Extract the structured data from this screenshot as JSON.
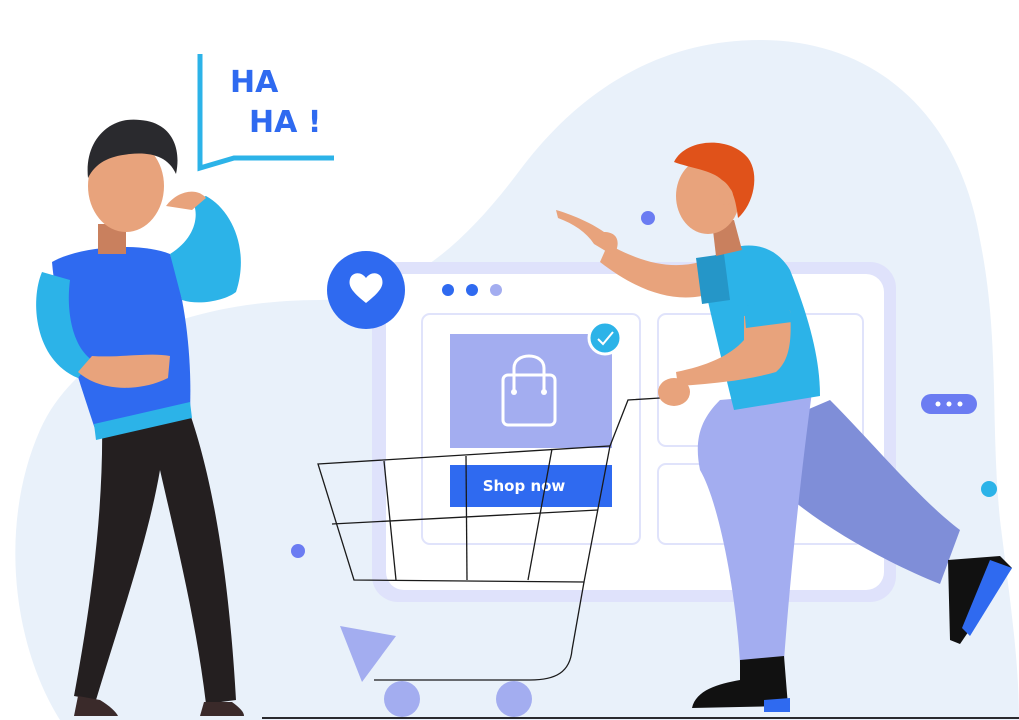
{
  "speech": {
    "line1": "HA",
    "line2": "HA !"
  },
  "shop_button": {
    "label": "Shop now"
  },
  "colors": {
    "blob": "#e9f1fa",
    "primary_blue": "#2f6af0",
    "sky_blue": "#2cb3e8",
    "lavender": "#a3adf0",
    "panel": "#d9ddfa",
    "skin": "#e8a37c",
    "hair_orange": "#e0521a",
    "hair_dark": "#2a2a2e",
    "pants_dark": "#241f20"
  },
  "icons": [
    "heart-icon",
    "shopping-bag-icon",
    "checkmark-icon",
    "more-dots-icon",
    "shopping-cart-icon"
  ]
}
